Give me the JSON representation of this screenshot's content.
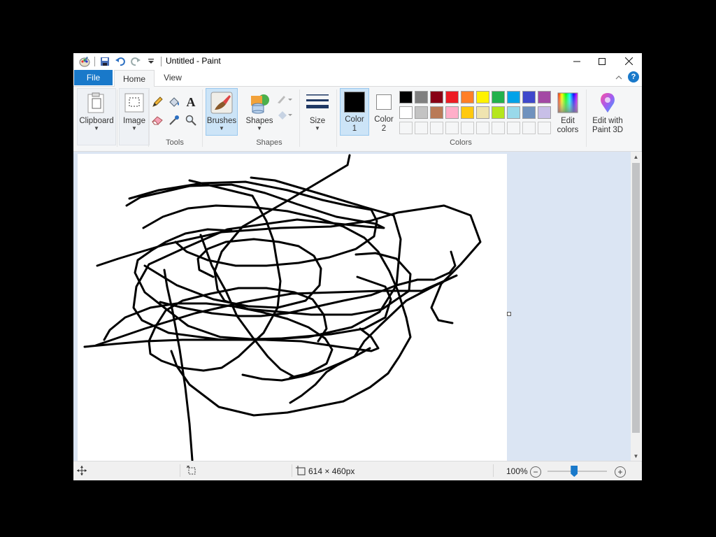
{
  "window": {
    "title": "Untitled - Paint",
    "controls": {
      "minimize": "minimize-icon",
      "maximize": "maximize-icon",
      "close": "close-icon"
    }
  },
  "tabs": {
    "file": "File",
    "home": "Home",
    "view": "View"
  },
  "ribbon": {
    "clipboard_label": "Clipboard",
    "image_label": "Image",
    "tools_group": "Tools",
    "brushes_label": "Brushes",
    "shapes_label": "Shapes",
    "shapes_group": "Shapes",
    "size_label": "Size",
    "color1_line1": "Color",
    "color1_line2": "1",
    "color2_line1": "Color",
    "color2_line2": "2",
    "colors_group": "Colors",
    "edit_colors_line1": "Edit",
    "edit_colors_line2": "colors",
    "edit3d_line1": "Edit with",
    "edit3d_line2": "Paint 3D",
    "color1_value": "#000000",
    "color2_value": "#ffffff",
    "palette_row1": [
      "#000000",
      "#7f7f7f",
      "#880015",
      "#ed1c24",
      "#ff7f27",
      "#fff200",
      "#22b14c",
      "#00a2e8",
      "#3f48cc",
      "#a349a4"
    ],
    "palette_row2": [
      "#ffffff",
      "#c3c3c3",
      "#b97a57",
      "#ffaec9",
      "#ffc90e",
      "#efe4b0",
      "#b5e61d",
      "#99d9ea",
      "#7092be",
      "#c8bfe7"
    ]
  },
  "status": {
    "canvas_size": "614 × 460px",
    "zoom": "100%",
    "zoom_fraction": 0.45
  }
}
